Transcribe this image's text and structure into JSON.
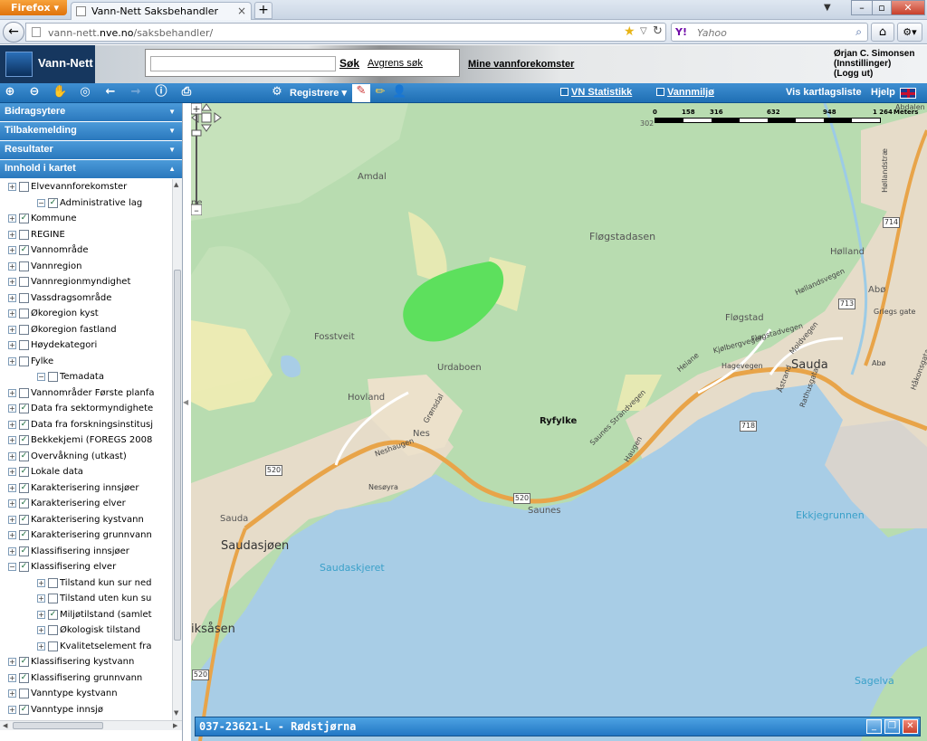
{
  "browser": {
    "app_button": "Firefox",
    "tab_title": "Vann-Nett Saksbehandler",
    "tab_close": "×",
    "new_tab": "+",
    "url_prefix": "vann-nett.",
    "url_domain": "nve.no",
    "url_path": "/saksbehandler/",
    "search_engine": "Y!",
    "search_placeholder": "Yahoo"
  },
  "header": {
    "logo_text": "Vann-Nett",
    "search_button": "Søk",
    "refine_link": "Avgrens søk",
    "my_waters_link": "Mine vannforekomster",
    "user_name": "Ørjan C. Simonsen",
    "settings": "(Innstillinger)",
    "logout": "(Logg ut)"
  },
  "toolbar": {
    "registrere": "Registrere",
    "vn_statistikk": "VN Statistikk",
    "vannmiljo": "Vannmiljø",
    "vis_kartlagsliste": "Vis kartlagsliste",
    "hjelp": "Hjelp"
  },
  "sidebar": {
    "panels": [
      {
        "label": "Bidragsytere"
      },
      {
        "label": "Tilbakemelding"
      },
      {
        "label": "Resultater"
      },
      {
        "label": "Innhold i kartet"
      }
    ],
    "tree": [
      {
        "label": "Elvevannforekomster",
        "level": 1,
        "checked": false
      },
      {
        "label": "Administrative lag",
        "level": 0,
        "checked": true,
        "expanded": true
      },
      {
        "label": "Kommune",
        "level": 1,
        "checked": true
      },
      {
        "label": "REGINE",
        "level": 1,
        "checked": false
      },
      {
        "label": "Vannområde",
        "level": 1,
        "checked": true
      },
      {
        "label": "Vannregion",
        "level": 1,
        "checked": false
      },
      {
        "label": "Vannregionmyndighet",
        "level": 1,
        "checked": false
      },
      {
        "label": "Vassdragsområde",
        "level": 1,
        "checked": false
      },
      {
        "label": "Økoregion kyst",
        "level": 1,
        "checked": false
      },
      {
        "label": "Økoregion fastland",
        "level": 1,
        "checked": false
      },
      {
        "label": "Høydekategori",
        "level": 1,
        "checked": false
      },
      {
        "label": "Fylke",
        "level": 1,
        "checked": false
      },
      {
        "label": "Temadata",
        "level": 0,
        "checked": false,
        "expanded": true
      },
      {
        "label": "Vannområder Første planfa",
        "level": 1,
        "checked": false
      },
      {
        "label": "Data fra sektormyndighete",
        "level": 1,
        "checked": true
      },
      {
        "label": "Data fra forskningsinstitusj",
        "level": 1,
        "checked": true
      },
      {
        "label": "Bekkekjemi (FOREGS 2008",
        "level": 1,
        "checked": true
      },
      {
        "label": "Overvåkning (utkast)",
        "level": 1,
        "checked": true
      },
      {
        "label": "Lokale data",
        "level": 1,
        "checked": true
      },
      {
        "label": "Karakterisering innsjøer",
        "level": 1,
        "checked": true
      },
      {
        "label": "Karakterisering elver",
        "level": 1,
        "checked": true
      },
      {
        "label": "Karakterisering kystvann",
        "level": 1,
        "checked": true
      },
      {
        "label": "Karakterisering grunnvann",
        "level": 1,
        "checked": true
      },
      {
        "label": "Klassifisering innsjøer",
        "level": 1,
        "checked": true
      },
      {
        "label": "Klassifisering elver",
        "level": 1,
        "checked": true,
        "expanded": true
      },
      {
        "label": "Tilstand kun sur ned",
        "level": 2,
        "checked": false
      },
      {
        "label": "Tilstand uten kun su",
        "level": 2,
        "checked": false
      },
      {
        "label": "Miljøtilstand (samlet",
        "level": 2,
        "checked": true
      },
      {
        "label": "Økologisk tilstand",
        "level": 2,
        "checked": false
      },
      {
        "label": "Kvalitetselement fra",
        "level": 2,
        "checked": false
      },
      {
        "label": "Klassifisering kystvann",
        "level": 1,
        "checked": true
      },
      {
        "label": "Klassifisering grunnvann",
        "level": 1,
        "checked": true
      },
      {
        "label": "Vanntype kystvann",
        "level": 1,
        "checked": false
      },
      {
        "label": "Vanntype innsjø",
        "level": 1,
        "checked": true
      }
    ]
  },
  "map": {
    "labels": {
      "amdal": "Amdal",
      "flogstadasen": "Fløgstadasen",
      "fosstveit": "Fosstveit",
      "urdaboen": "Urdaboen",
      "hovland": "Hovland",
      "gronsdal": "Grønsdal",
      "nes": "Nes",
      "neshaugen": "Neshaugen",
      "ryfylke": "Ryfylke",
      "nesoyra": "Nesøyra",
      "saunes": "Saunes",
      "sauda_small": "Sauda",
      "saudasjoen": "Saudasjøen",
      "saudaskjeret": "Saudaskjeret",
      "iksasen": "iksåsen",
      "ekkjegrunnen": "Ekkjegrunnen",
      "sagelva": "Sagelva",
      "sauda": "Sauda",
      "flogstad": "Fløgstad",
      "holland": "Hølland",
      "abo": "Abø",
      "abo2": "Abø",
      "abdalen": "Abdalen",
      "hollandsvegen": "Høllandsvegen",
      "flogstadvegen": "Fløgstadvegen",
      "kjolbergvegen": "Kjølbergvegen",
      "hagevegen": "Hagevegen",
      "saunes_strandvegen": "Saunes Strandvegen",
      "moldvegen": "Moldvegen",
      "griegs_gate": "Griegs gate",
      "hakonsgata": "Håkonsgata",
      "rathusgata": "Rathusgata",
      "astrand": "Åstrand",
      "heiane": "Heiane",
      "haugen": "Haugen",
      "ne": "ne",
      "hoellandstra": "Høllandstræ",
      "elevation": "302"
    },
    "road_shields": [
      "520",
      "520",
      "520",
      "718",
      "713",
      "714"
    ],
    "scale": {
      "ticks": [
        "0",
        "158",
        "316",
        "632",
        "948",
        "1 264"
      ],
      "unit": "Meters"
    },
    "info_window": {
      "title": "037-23621-L - Rødstjørna"
    },
    "colors": {
      "water": "#a8cde6",
      "land": "#b8dcb0",
      "urban": "#e6dcc9",
      "lake_highlight": "#5de05d",
      "road": "#e8a449"
    }
  }
}
